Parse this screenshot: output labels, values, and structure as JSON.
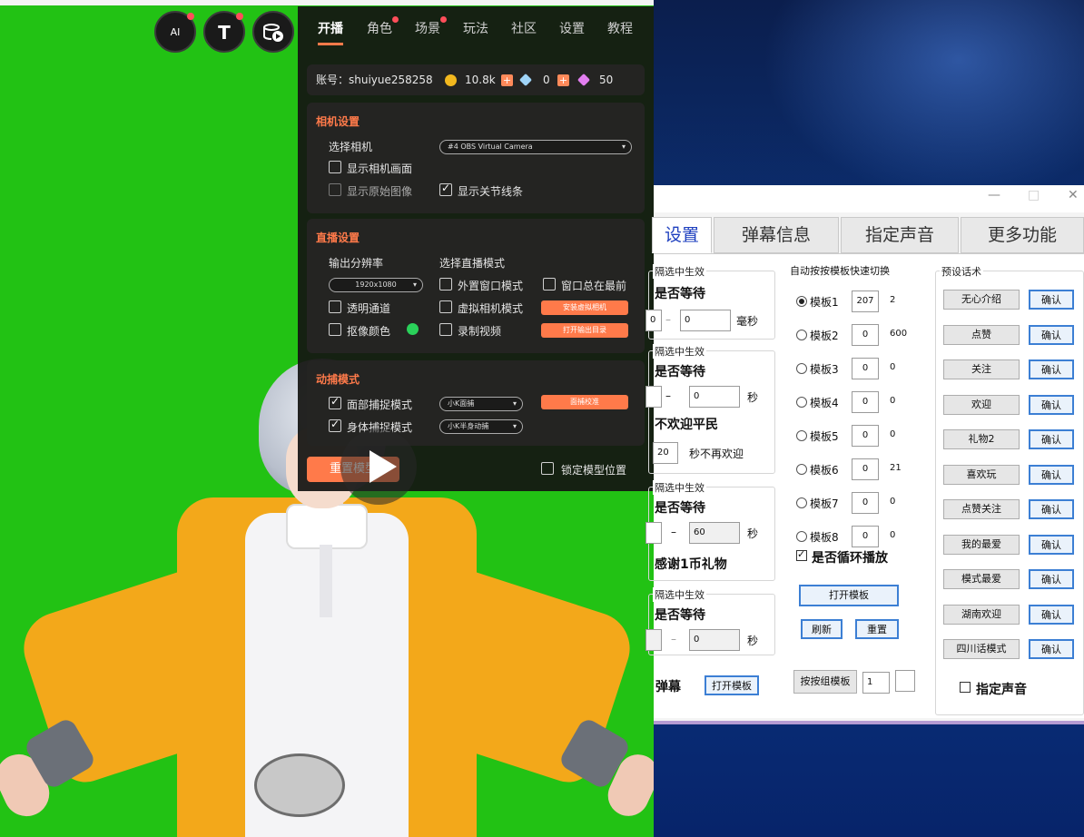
{
  "top_icons": [
    {
      "name": "ai-mic",
      "label": "AI"
    },
    {
      "name": "model",
      "label": "T"
    },
    {
      "name": "media",
      "label": ""
    }
  ],
  "panel": {
    "tabs": [
      "开播",
      "角色",
      "场景",
      "玩法",
      "社区",
      "设置",
      "教程"
    ],
    "account": {
      "label": "账号：shuiyue258258",
      "coins": "10.8k",
      "diamonds": "0",
      "gems": "50"
    },
    "camera": {
      "title": "相机设置",
      "select_label": "选择相机",
      "select_value": "#4 OBS Virtual Camera",
      "show_camera": "显示相机画面",
      "show_raw": "显示原始图像",
      "show_joints": "显示关节线条"
    },
    "live": {
      "title": "直播设置",
      "resolution_label": "输出分辨率",
      "resolution_value": "1920x1080",
      "mode_label": "选择直播模式",
      "transparent": "透明通道",
      "chroma": "抠像颜色",
      "external": "外置窗口模式",
      "always_top": "窗口总在最前",
      "virtual_cam": "虚拟相机模式",
      "record": "录制视频",
      "install_btn": "安装虚拟相机",
      "open_dir_btn": "打开输出目录"
    },
    "capture": {
      "title": "动捕模式",
      "face": "面部捕捉模式",
      "face_select": "小K面捕",
      "body": "身体捕捉模式",
      "body_select": "小K半身动捕",
      "calibrate": "面捕校准"
    },
    "reset": "重置模型",
    "lock_pos": "锁定模型位置"
  },
  "window": {
    "controls": [
      "—",
      "□",
      "✕"
    ],
    "tabs": [
      "设置",
      "弹幕信息",
      "指定声音",
      "更多功能"
    ],
    "left_groups": [
      {
        "title": "隔选中生效",
        "wait": "是否等待",
        "from": "0",
        "to": "0",
        "unit": "毫秒"
      },
      {
        "title": "隔选中生效",
        "wait": "是否等待",
        "from": "",
        "to": "0",
        "unit": "秒",
        "extra": "不欢迎平民",
        "extra_val": "20",
        "extra_unit": "秒不再欢迎"
      },
      {
        "title": "隔选中生效",
        "wait": "是否等待",
        "from": "",
        "to": "60",
        "unit": "秒",
        "extra": "感谢1币礼物"
      },
      {
        "title": "隔选中生效",
        "wait": "是否等待",
        "from": "",
        "to": "0",
        "unit": "秒"
      }
    ],
    "danmu_label": "弹幕",
    "open_template": "打开模板",
    "auto_switch_title": "自动按按模板快速切换",
    "templates": [
      {
        "label": "模板1",
        "val": "207",
        "num": "2"
      },
      {
        "label": "模板2",
        "val": "0",
        "num": "600"
      },
      {
        "label": "模板3",
        "val": "0",
        "num": "0"
      },
      {
        "label": "模板4",
        "val": "0",
        "num": "0"
      },
      {
        "label": "模板5",
        "val": "0",
        "num": "0"
      },
      {
        "label": "模板6",
        "val": "0",
        "num": "21"
      },
      {
        "label": "模板7",
        "val": "0",
        "num": "0"
      },
      {
        "label": "模板8",
        "val": "0",
        "num": "0"
      }
    ],
    "loop_label": "是否循环播放",
    "open_tpl_btn": "打开模板",
    "refresh_btn": "刷新",
    "reset_btn": "重置",
    "group_tpl_btn": "按按组模板",
    "group_tpl_val": "1",
    "preset_title": "预设话术",
    "presets": [
      "无心介绍",
      "点赞",
      "关注",
      "欢迎",
      "礼物2",
      "喜欢玩",
      "点赞关注",
      "我的最爱",
      "模式最爱",
      "湖南欢迎",
      "四川话模式"
    ],
    "confirm": "确认",
    "specify_voice": "指定声音"
  }
}
